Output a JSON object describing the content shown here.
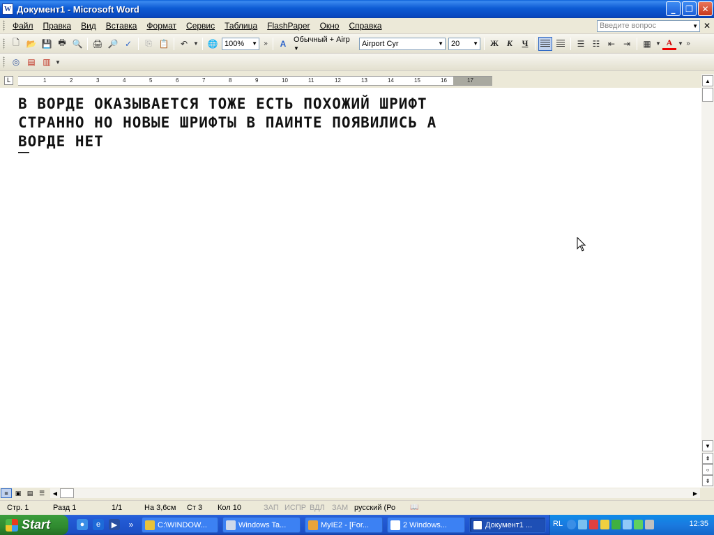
{
  "window": {
    "title": "Документ1 - Microsoft Word"
  },
  "menu": {
    "items": [
      "Файл",
      "Правка",
      "Вид",
      "Вставка",
      "Формат",
      "Сервис",
      "Таблица",
      "FlashPaper",
      "Окно",
      "Справка"
    ],
    "help_placeholder": "Введите вопрос"
  },
  "toolbar": {
    "zoom": "100%",
    "style": "Обычный + Airp",
    "font": "Airport Cyr",
    "size": "20",
    "bold": "Ж",
    "italic": "К",
    "underline": "Ч",
    "font_color": "A"
  },
  "ruler": {
    "numbers": [
      "1",
      "2",
      "3",
      "4",
      "5",
      "6",
      "7",
      "8",
      "9",
      "10",
      "11",
      "12",
      "13",
      "14",
      "15",
      "16",
      "17"
    ]
  },
  "document": {
    "lines": [
      "В ВОРДЕ ОКАЗЫВАЕТСЯ ТОЖЕ ЕСТЬ ПОХОЖИЙ ШРИФТ",
      "СТРАННО НО НОВЫЕ ШРИФТЫ В ПАИНТЕ ПОЯВИЛИСЬ А",
      "ВОРДЕ НЕТ"
    ]
  },
  "status": {
    "page": "Стр. 1",
    "section": "Разд 1",
    "pages": "1/1",
    "position": "На 3,6см",
    "line": "Ст 3",
    "column": "Кол 10",
    "rec": "ЗАП",
    "trk": "ИСПР",
    "ext": "ВДЛ",
    "ovr": "ЗАМ",
    "language": "русский (Ро"
  },
  "taskbar": {
    "start": "Start",
    "tasks": [
      "C:\\WINDOW...",
      "Windows Ta...",
      "MyIE2 - [For...",
      "2 Windows...",
      "Документ1 ..."
    ],
    "lang": "RL",
    "clock": "12:35"
  }
}
